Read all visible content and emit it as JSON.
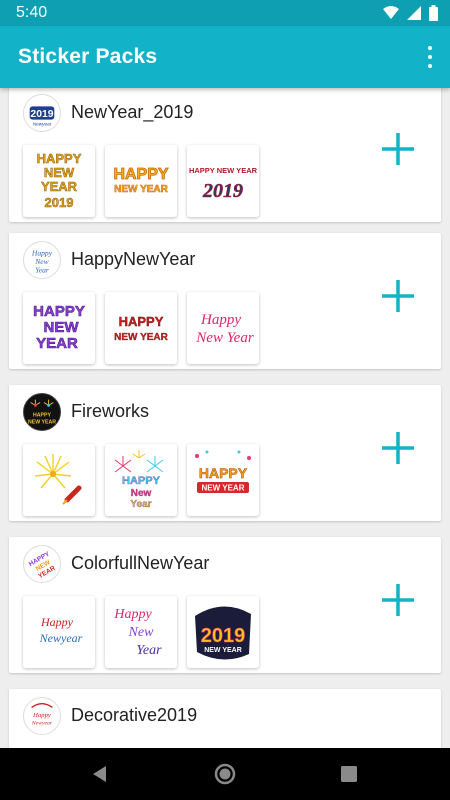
{
  "status": {
    "time": "5:40"
  },
  "app_bar": {
    "title": "Sticker Packs"
  },
  "packs": [
    {
      "name": "NewYear_2019"
    },
    {
      "name": "HappyNewYear"
    },
    {
      "name": "Fireworks"
    },
    {
      "name": "ColorfullNewYear"
    },
    {
      "name": "Decorative2019"
    }
  ],
  "icon_texts": {
    "happy_new_year_upper": [
      "HAPPY",
      "NEW",
      "YEAR"
    ],
    "happy": "Happy",
    "new": "New",
    "year": "Year",
    "newyear": "Newyear",
    "happy_new_year_cursive": [
      "Happy",
      "New Year"
    ],
    "happy_new_year_one_line": "HAPPY NEW YEAR",
    "year_2019": "2019",
    "new_year_upper": "NEW YEAR"
  },
  "colors": {
    "status_bar": "#0e9fb3",
    "app_bar": "#12b3c9",
    "accent_plus": "#12b3c9",
    "background": "#eeeeee"
  },
  "icons": [
    "wifi-icon",
    "signal-icon",
    "battery-icon",
    "more-vert-icon",
    "plus-icon",
    "back-icon",
    "home-icon",
    "recents-icon"
  ]
}
